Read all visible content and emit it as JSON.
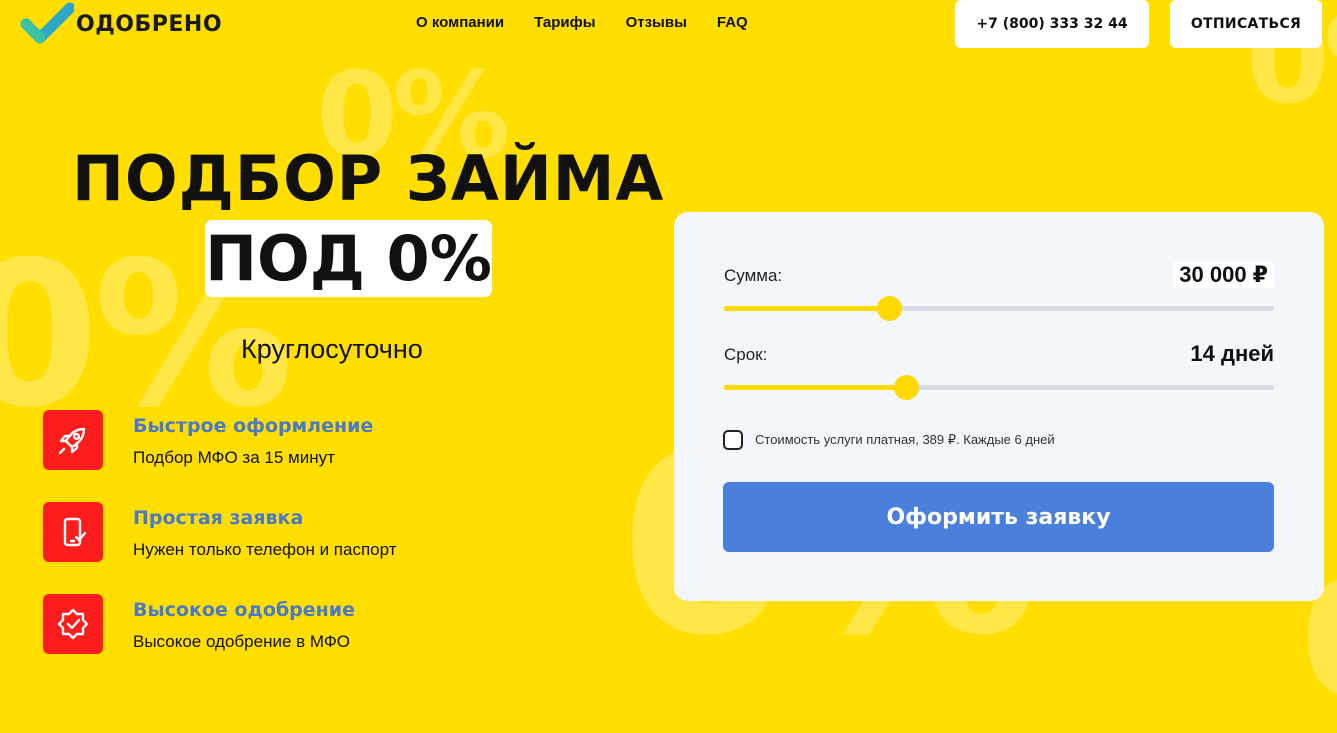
{
  "header": {
    "logo_text": "ОДОБРЕНО",
    "nav": [
      "О компании",
      "Тарифы",
      "Отзывы",
      "FAQ"
    ],
    "phone": "+7 (800) 333 32 44",
    "unsubscribe": "ОТПИСАТЬСЯ"
  },
  "background": {
    "mark": "0%"
  },
  "hero": {
    "title_line1": "ПОДБОР ЗАЙМА",
    "title_line2": "ПОД 0%",
    "subtitle": "Круглосуточно"
  },
  "features": [
    {
      "icon": "rocket-icon",
      "title": "Быстрое оформление",
      "description": "Подбор МФО за 15 минут"
    },
    {
      "icon": "phone-check-icon",
      "title": "Простая заявка",
      "description": "Нужен только телефон и паспорт"
    },
    {
      "icon": "badge-check-icon",
      "title": "Высокое одобрение",
      "description": "Высокое одобрение в МФО"
    }
  ],
  "form": {
    "amount_label": "Сумма:",
    "amount_value": "30 000 ₽",
    "amount_fraction": 0.3,
    "term_label": "Срок:",
    "term_value": "14 дней",
    "term_fraction": 0.33,
    "fee_text": "Стоимость услуги платная, 389 ₽. Каждые 6 дней",
    "submit_label": "Оформить заявку"
  },
  "colors": {
    "background": "#ffde00",
    "accent_blue": "#4a80dc",
    "feature_title": "#4a79c7",
    "icon_red": "#ff1c1c",
    "slider": "#ffd900"
  }
}
